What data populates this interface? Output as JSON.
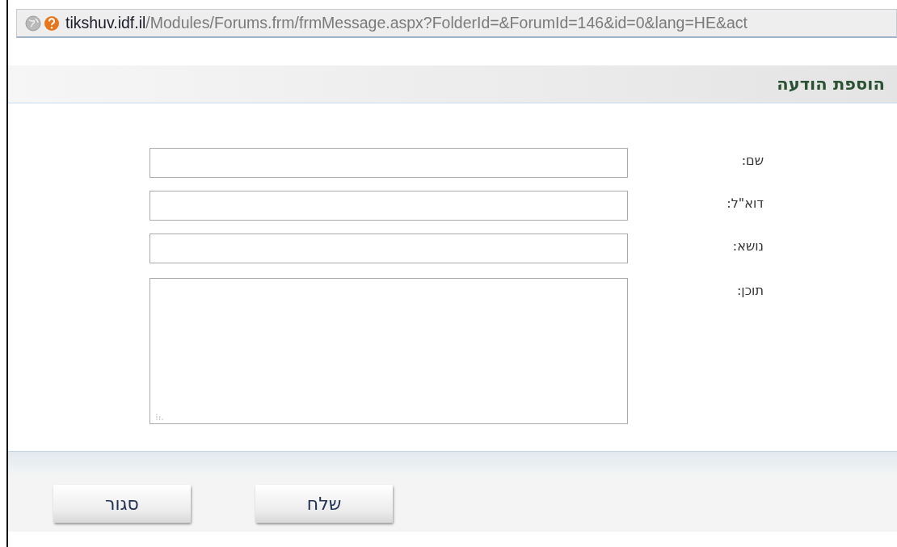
{
  "address_bar": {
    "host": "tikshuv.idf.il",
    "path": "/Modules/Forums.frm/frmMessage.aspx?FolderId=&ForumId=146&id=0&lang=HE&act"
  },
  "title": "הוספת הודעה",
  "fields": [
    {
      "label": "שם:",
      "kind": "input"
    },
    {
      "label": "דוא\"ל:",
      "kind": "input"
    },
    {
      "label": "נושא:",
      "kind": "input"
    },
    {
      "label": "תוכן:",
      "kind": "textarea"
    }
  ],
  "buttons": [
    "שלח",
    "סגור"
  ]
}
